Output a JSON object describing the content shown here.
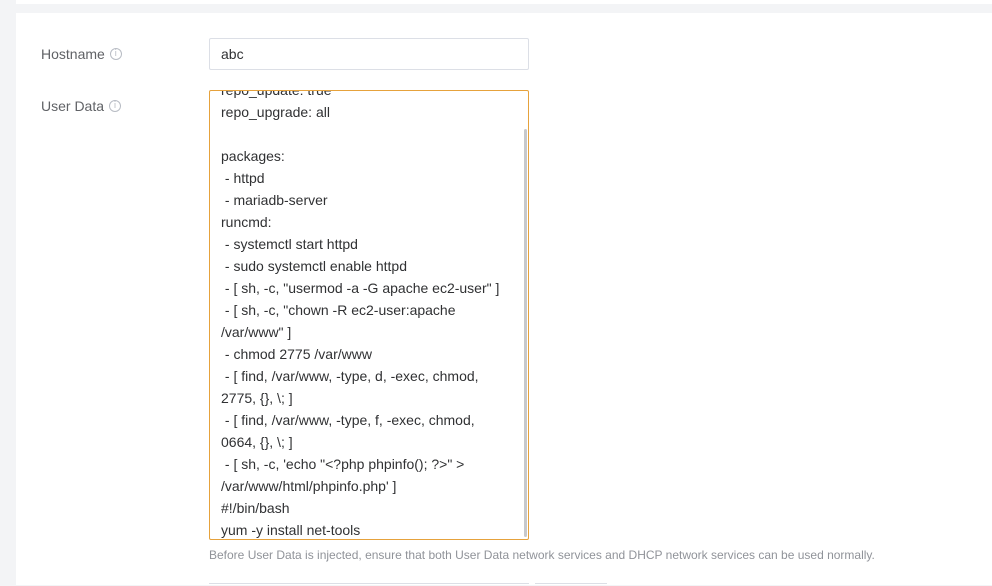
{
  "form": {
    "hostname": {
      "label": "Hostname",
      "value": "abc",
      "info_icon": "info-icon"
    },
    "user_data": {
      "label": "User Data",
      "info_icon": "info-icon",
      "value": "repo_update: true\nrepo_upgrade: all\n\npackages:\n - httpd\n - mariadb-server\nruncmd:\n - systemctl start httpd\n - sudo systemctl enable httpd\n - [ sh, -c, \"usermod -a -G apache ec2-user\" ]\n - [ sh, -c, \"chown -R ec2-user:apache /var/www\" ]\n - chmod 2775 /var/www\n - [ find, /var/www, -type, d, -exec, chmod, 2775, {}, \\; ]\n - [ find, /var/www, -type, f, -exec, chmod, 0664, {}, \\; ]\n - [ sh, -c, 'echo \"<?php phpinfo(); ?>\" > /var/www/html/phpinfo.php' ]\n#!/bin/bash\nyum -y install net-tools",
      "hint": "Before User Data is injected, ensure that both User Data network services and DHCP network services can be used normally."
    }
  },
  "colors": {
    "focus_border": "#e6a23c",
    "label": "#606266",
    "hint": "#909399"
  }
}
